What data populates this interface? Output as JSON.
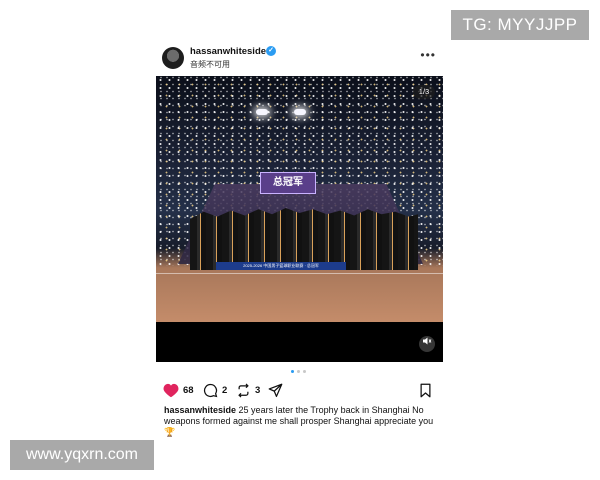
{
  "watermarks": {
    "top": "TG: MYYJJPP",
    "bottom": "www.yqxrn.com"
  },
  "post": {
    "username": "hassanwhiteside",
    "subtitle": "音频不可用",
    "more_label": "•••",
    "media": {
      "counter": "1/3",
      "banner_text": "总冠军",
      "front_banner_text": "2025-2026 中国男子篮球职业联赛 · 总冠军",
      "sound_icon": "speaker-muted-icon"
    },
    "carousel": {
      "count": 3,
      "active": 0
    },
    "actions": {
      "likes": "68",
      "comments": "2",
      "reposts": "3"
    },
    "caption": {
      "username": "hassanwhiteside",
      "text": "25 years later the Trophy back in Shanghai No weapons formed against me shall prosper  Shanghai appreciate you",
      "emoji": "🏆"
    },
    "colors": {
      "accent": "#2b9cf2",
      "like": "#e0245e"
    }
  }
}
